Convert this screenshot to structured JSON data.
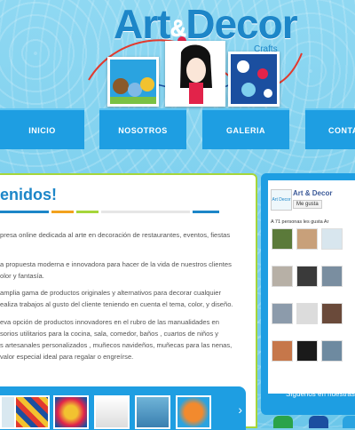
{
  "header": {
    "logo_main": "Art",
    "logo_amp": "&",
    "logo_second": "Decor",
    "logo_sub": "Crafts"
  },
  "nav": {
    "items": [
      {
        "label": "INICIO"
      },
      {
        "label": "NOSOTROS"
      },
      {
        "label": "GALERIA"
      },
      {
        "label": "CONTA"
      }
    ]
  },
  "content": {
    "title": "enidos!",
    "paragraphs": [
      "presa online dedicada al arte en decoración de restaurantes, eventos, fiestas",
      "a propuesta moderna e innovadora para hacer de la vida de nuestros clientes",
      "olor y fantasía.",
      " amplia gama de productos originales y alternativos para decorar cualquier",
      "ealiza trabajos al gusto del cliente teniendo en cuenta el tema, color, y diseño.",
      "eva opción de productos innovadores en el rubro de las manualidades en",
      "sorios utilitarios para la cocina, sala, comedor, baños , cuartos de niños y",
      "s artesanales personalizados , muñecos navideños, muñecas para las nenas,",
      " valor especial ideal para regalar o engreírse."
    ]
  },
  "gallery": {
    "next_arrow": "›"
  },
  "sidebar": {
    "fb_logo_text": "Art Decor",
    "page_name": "Art & Decor",
    "like_label": "Me gusta",
    "fan_count": "A 71 personas les gusta Ar",
    "follow_text": "Síguenos en nuestras"
  },
  "colors": {
    "accent": "#1e9ee2",
    "brand_blue": "#1d86c8",
    "panel_border": "#a6d63a"
  }
}
